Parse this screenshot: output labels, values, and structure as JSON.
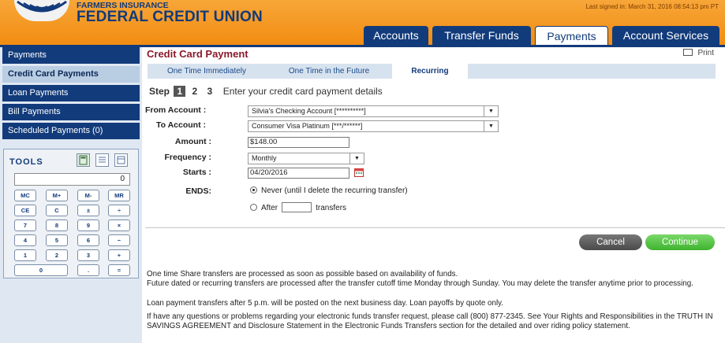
{
  "brand": {
    "line1": "FARMERS INSURANCE",
    "line2": "FEDERAL CREDIT UNION"
  },
  "last_signed": "Last signed in: March 31, 2016 08:54:13 pm PT",
  "nav": {
    "tabs": [
      {
        "label": "Accounts",
        "active": false
      },
      {
        "label": "Transfer Funds",
        "active": false
      },
      {
        "label": "Payments",
        "active": true
      },
      {
        "label": "Account Services",
        "active": false
      }
    ]
  },
  "sidebar": {
    "items": [
      {
        "label": "Payments",
        "active": false
      },
      {
        "label": "Credit Card Payments",
        "active": true
      },
      {
        "label": "Loan Payments",
        "active": false
      },
      {
        "label": "Bill Payments",
        "active": false
      },
      {
        "label": "Scheduled Payments (0)",
        "active": false
      }
    ],
    "tools_title": "TOOLS",
    "calculator": {
      "display": "0",
      "keys": [
        [
          "MC",
          "M+",
          "M-",
          "MR"
        ],
        [
          "CE",
          "C",
          "±",
          "÷"
        ],
        [
          "7",
          "8",
          "9",
          "×"
        ],
        [
          "4",
          "5",
          "6",
          "−"
        ],
        [
          "1",
          "2",
          "3",
          "+"
        ],
        [
          "0",
          ".",
          "="
        ]
      ]
    }
  },
  "main": {
    "title": "Credit Card Payment",
    "print_label": "Print",
    "subtabs": [
      {
        "label": "One Time Immediately",
        "active": false
      },
      {
        "label": "One Time in the Future",
        "active": false
      },
      {
        "label": "Recurring",
        "active": true
      }
    ],
    "steps": {
      "label": "Step",
      "numbers": [
        "1",
        "2",
        "3"
      ],
      "current": 1,
      "text": "Enter your credit card payment details"
    },
    "form": {
      "from_label": "From Account :",
      "from_value": "Silvia's Checking Account  [**********]",
      "to_label": "To Account :",
      "to_value": "Consumer Visa Platinum  [***/******]",
      "amount_label": "Amount :",
      "amount_value": "$148.00",
      "frequency_label": "Frequency :",
      "frequency_value": "Monthly",
      "starts_label": "Starts :",
      "starts_value": "04/20/2016",
      "ends_label": "ENDS:",
      "ends_never": "Never (until I delete the recurring transfer)",
      "ends_after_prefix": "After",
      "ends_after_suffix": "transfers",
      "ends_selected": "never"
    },
    "buttons": {
      "cancel": "Cancel",
      "continue": "Continue"
    },
    "notes": [
      "One time Share transfers are processed as soon as possible based on availability of funds.",
      "Future dated or recurring transfers are processed after the transfer cutoff time Monday through Sunday. You may delete the transfer anytime prior to processing.",
      "Loan payment transfers after 5 p.m. will be posted on the next business day. Loan payoffs by quote only.",
      "If have any questions or problems regarding your electronic funds transfer request, please call (800) 877-2345. See Your Rights and Responsibilities in the TRUTH IN SAVINGS AGREEMENT and  Disclosure Statement in the Electronic Funds Transfers section for the detailed and over riding policy statement."
    ]
  },
  "colors": {
    "brand_orange": "#f28c12",
    "nav_blue": "#123b7b",
    "title_red": "#8b1a2b",
    "continue_green": "#4fc23c",
    "cancel_gray": "#5a5a5a"
  }
}
